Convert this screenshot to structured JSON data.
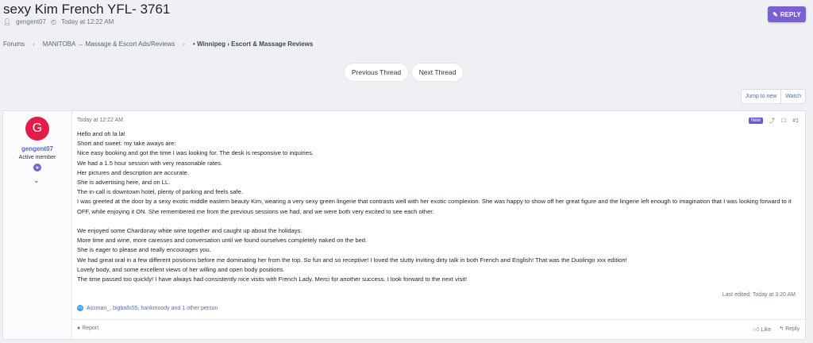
{
  "thread": {
    "title": "sexy Kim French YFL- 3761",
    "author": "gengent07",
    "date": "Today at 12:22 AM"
  },
  "reply_label": "REPLY",
  "breadcrumb": {
    "items": [
      "Forums",
      "MANITOBA → Massage & Escort Ads/Reviews",
      "• Winnipeg › Escort & Massage Reviews"
    ]
  },
  "navigation": {
    "prev": "Previous Thread",
    "next": "Next Thread"
  },
  "controls": {
    "jump": "Jump to new",
    "watch": "Watch"
  },
  "post": {
    "avatar_letter": "G",
    "username": "gengent07",
    "user_title": "Active member",
    "timestamp": "Today at 12:22 AM",
    "new_badge": "New",
    "number": "#1",
    "lines": [
      "Hello and oh la la!",
      "Short and sweet: my take aways are:",
      "Nice easy booking and got the time I was looking for. The desk is responsive to inquiries.",
      "We had a 1.5 hour session with very reasonable rates.",
      "Her pictures and description are accurate.",
      "She is advertising here, and on LL.",
      "The in-call is downtown hotel, plenty of parking and feels safe.",
      "I was greeted at the door by a sexy exotic middle eastern beauty Kim, wearing a very sexy green lingerie that contrasts well with her exotic complexion. She was happy to show off her great figure and the lingerie left enough to imagination that I was looking forward to it OFF, while enjoying it ON. She remembered me from the previous sessions we had, and we were both very excited to see each other.",
      "",
      "We enjoyed some Chardonay white wine together and caught up about the holidays.",
      "More time and wine, more caresses and conversation until we found ourselves completely naked on the bed.",
      "She is eager to please and really encourages you.",
      "We had great oral in a few different positions before me dominating her from the top. So fun and so receptive! I loved the slutty inviting dirty talk in both French and English! That was the Duolingo xxx edition!",
      "Lovely body, and some excellent views of her willing and open body positions.",
      "The time passed too quickly! I have always had consistently nice visits with French Lady. Merci for another success. I look forward to the next visit!"
    ],
    "last_edited": "Last edited: Today at 3:20 AM",
    "reactions": "Assman_, bigballs55, hankmoody and 1 other person",
    "report": "Report",
    "like": "Like",
    "reply": "Reply"
  }
}
